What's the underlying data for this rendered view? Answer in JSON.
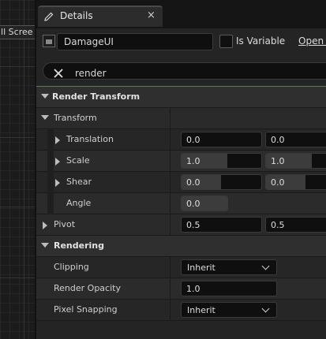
{
  "canvas": {
    "label": "ill Scree"
  },
  "tab": {
    "title": "Details",
    "close_glyph": "×"
  },
  "header": {
    "widget_name": "DamageUI",
    "is_variable_label": "Is Variable",
    "open_link": "Open I"
  },
  "search": {
    "value": "render"
  },
  "sections": {
    "render_transform": "Render Transform",
    "transform": "Transform",
    "translation": {
      "label": "Translation",
      "x": "0.0",
      "y": "0.0"
    },
    "scale": {
      "label": "Scale",
      "x": "1.0",
      "y": "1.0"
    },
    "shear": {
      "label": "Shear",
      "x": "0.0",
      "y": "0.0"
    },
    "angle": {
      "label": "Angle",
      "value": "0.0"
    },
    "pivot": {
      "label": "Pivot",
      "x": "0.5",
      "y": "0.5"
    },
    "rendering": "Rendering",
    "clipping": {
      "label": "Clipping",
      "value": "Inherit"
    },
    "render_opacity": {
      "label": "Render Opacity",
      "value": "1.0"
    },
    "pixel_snapping": {
      "label": "Pixel Snapping",
      "value": "Inherit"
    }
  },
  "icons": {
    "tab": "pencil-icon",
    "widget": "widget-icon",
    "clear": "close-x-icon"
  },
  "colors": {
    "accent": "#2f7ad6",
    "panel": "#242424"
  }
}
